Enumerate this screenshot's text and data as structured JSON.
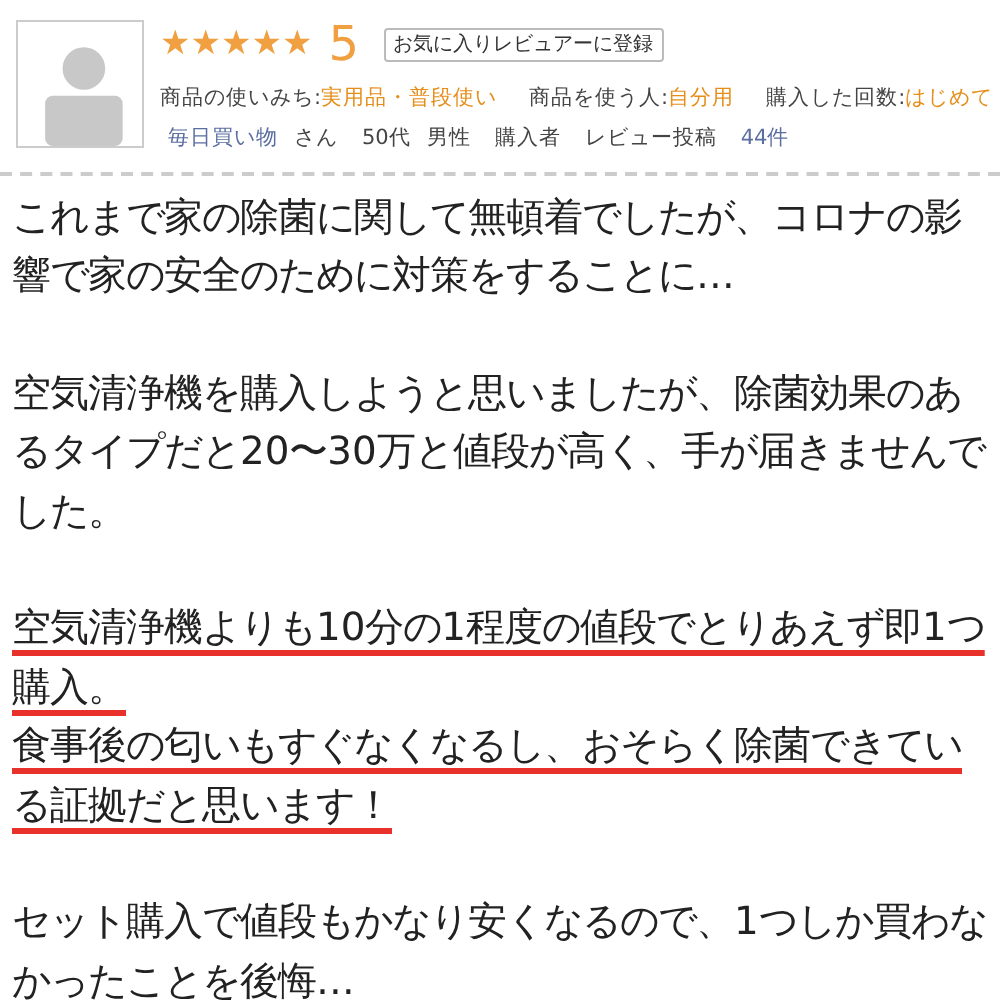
{
  "reviewer": {
    "stars": 5,
    "rating": "5",
    "favorite_button": "お気に入りレビュアーに登録",
    "attributes": [
      {
        "label": "商品の使いみち:",
        "value": "実用品・普段使い"
      },
      {
        "label": "商品を使う人:",
        "value": "自分用"
      },
      {
        "label": "購入した回数:",
        "value": "はじめて"
      }
    ],
    "name": "毎日買い物",
    "honorific": "さん",
    "age": "50代",
    "gender": "男性",
    "buyer": "購入者",
    "review_label": "レビュー投稿",
    "review_count": "44件"
  },
  "paragraphs": [
    {
      "sentences": [
        {
          "text": "これまで家の除菌に関して無頓着でしたが、コロナの影響で家の安全のために対策をすることに…",
          "underlined": false
        }
      ]
    },
    {
      "sentences": [
        {
          "text": "空気清浄機を購入しようと思いましたが、除菌効果のあるタイプだと20〜30万と値段が高く、手が届きませんでした。",
          "underlined": false
        }
      ]
    },
    {
      "sentences": [
        {
          "text": "空気清浄機よりも10分の1程度の値段でとりあえず即1つ購入。",
          "underlined": true
        },
        {
          "text": "食事後の匂いもすぐなくなるし、おそらく除菌できている証拠だと思います！",
          "underlined": true
        }
      ]
    },
    {
      "sentences": [
        {
          "text": "セット購入で値段もかなり安くなるので、1つしか買わなかったことを後悔…",
          "underlined": false
        }
      ]
    }
  ]
}
